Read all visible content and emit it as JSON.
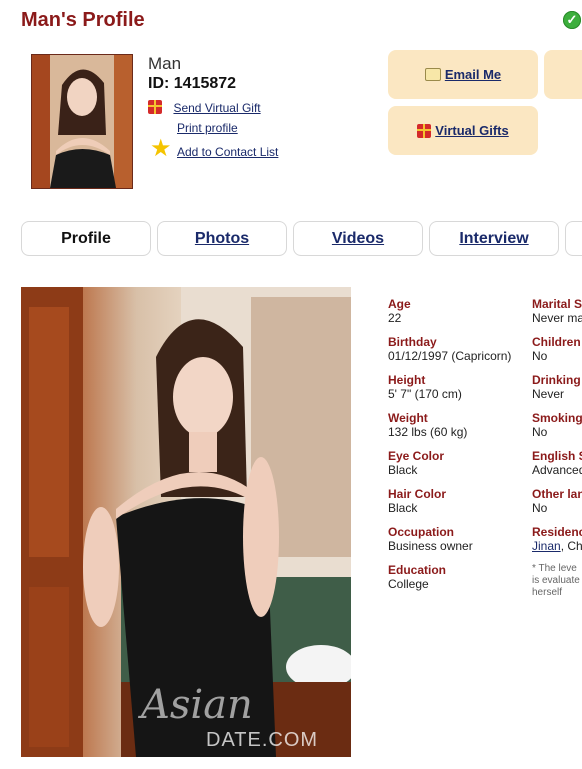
{
  "page": {
    "title": "Man's Profile"
  },
  "profile": {
    "name": "Man",
    "id_text": "ID: 1415872",
    "links": {
      "send_gift": "Send Virtual Gift",
      "print": "Print profile",
      "add_contact": "Add to Contact List"
    }
  },
  "actions": {
    "email": "Email Me",
    "virtual_gifts": "Virtual Gifts"
  },
  "tabs": [
    "Profile",
    "Photos",
    "Videos",
    "Interview"
  ],
  "watermark": {
    "script": "Asian",
    "brand": "DATE.COM"
  },
  "details_left": [
    {
      "label": "Age",
      "value": "22"
    },
    {
      "label": "Birthday",
      "value": "01/12/1997 (Capricorn)"
    },
    {
      "label": "Height",
      "value": "5' 7\" (170 cm)"
    },
    {
      "label": "Weight",
      "value": "132 lbs (60 kg)"
    },
    {
      "label": "Eye Color",
      "value": "Black"
    },
    {
      "label": "Hair Color",
      "value": "Black"
    },
    {
      "label": "Occupation",
      "value": "Business owner"
    },
    {
      "label": "Education",
      "value": "College"
    }
  ],
  "details_right": [
    {
      "label": "Marital S",
      "value": "Never ma"
    },
    {
      "label": "Children",
      "value": "No"
    },
    {
      "label": "Drinking",
      "value": "Never"
    },
    {
      "label": "Smoking",
      "value": "No"
    },
    {
      "label": "English S",
      "value": "Advanced"
    },
    {
      "label": "Other lan",
      "value": "No"
    },
    {
      "label": "Residenc",
      "value_link": "Jinan",
      "value_rest": ", Ch"
    }
  ],
  "english_note": [
    "* The leve",
    "is evaluate",
    "herself"
  ],
  "colors": {
    "accent": "#8b1a1a",
    "button_bg": "#fbe7c2",
    "link": "#1a2a6a"
  }
}
